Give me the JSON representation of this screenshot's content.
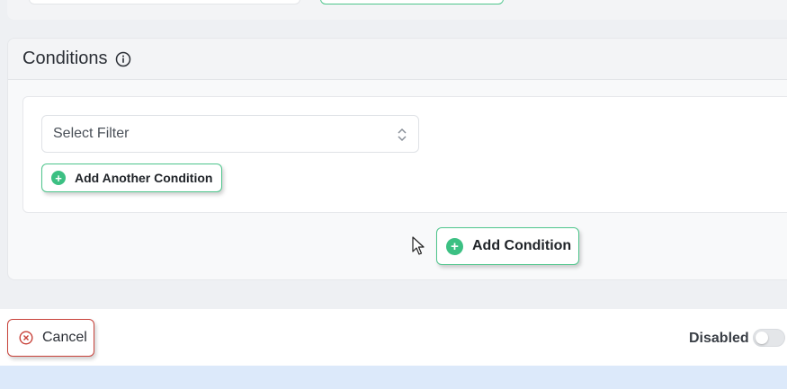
{
  "conditions": {
    "title": "Conditions",
    "select_filter": {
      "value": "Select Filter"
    },
    "add_another_label": "Add Another Condition",
    "add_condition_label": "Add Condition"
  },
  "footer": {
    "cancel_label": "Cancel",
    "status_label": "Disabled",
    "toggle_on": false
  },
  "colors": {
    "accent_green": "#3cc083",
    "cancel_red": "#c8423a"
  },
  "icons": {
    "info": "info-icon",
    "plus": "plus-circle-icon",
    "chevron": "chevron-up-down-icon",
    "cancel": "x-circle-icon",
    "cursor": "mouse-pointer-icon"
  }
}
